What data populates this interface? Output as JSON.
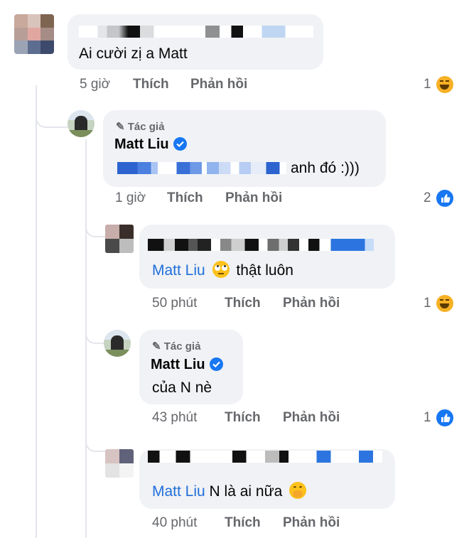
{
  "comments": [
    {
      "text": "Ai cười zị a Matt",
      "time": "5 giờ",
      "like_label": "Thích",
      "reply_label": "Phản hồi",
      "reaction_count": "1",
      "reaction_icon": "haha-icon"
    },
    {
      "author_badge": "Tác giả",
      "author": "Matt Liu",
      "text": "anh đó :)))",
      "time": "1 giờ",
      "like_label": "Thích",
      "reply_label": "Phản hồi",
      "reaction_count": "2",
      "reaction_icon": "like-icon"
    },
    {
      "mention": "Matt Liu",
      "text": "thật luôn",
      "time": "50 phút",
      "like_label": "Thích",
      "reply_label": "Phản hồi",
      "reaction_count": "1",
      "reaction_icon": "haha-icon"
    },
    {
      "author_badge": "Tác giả",
      "author": "Matt Liu",
      "text": "của N nè",
      "time": "43 phút",
      "like_label": "Thích",
      "reply_label": "Phản hồi",
      "reaction_count": "1",
      "reaction_icon": "like-icon"
    },
    {
      "mention": "Matt Liu",
      "text": "N là ai nữa",
      "time": "40 phút",
      "like_label": "Thích",
      "reply_label": "Phản hồi"
    }
  ],
  "colors": {
    "bubble": "#f0f2f5",
    "meta": "#65676b",
    "mention": "#216fdb",
    "like_blue": "#1877f2",
    "haha_yellow": "#f7b125"
  }
}
